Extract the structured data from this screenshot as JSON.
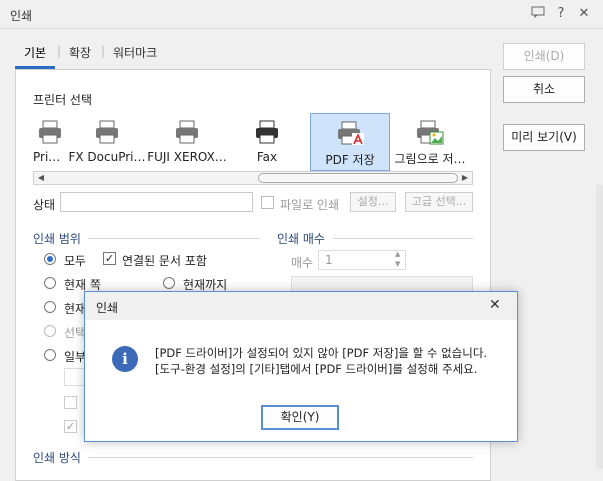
{
  "window": {
    "title": "인쇄"
  },
  "titlebar_icons": [
    "chat-icon",
    "help-icon",
    "close-icon"
  ],
  "tabs": [
    {
      "label": "기본",
      "active": true
    },
    {
      "label": "확장"
    },
    {
      "label": "워터마크"
    }
  ],
  "printer_section": {
    "title": "프린터 선택"
  },
  "printers": [
    {
      "label": "Pri…"
    },
    {
      "label": "FX DocuPri…"
    },
    {
      "label": "FUJI XEROX…"
    },
    {
      "label": "Fax"
    },
    {
      "label": "PDF 저장",
      "selected": true
    },
    {
      "label": "그림으로 저…"
    }
  ],
  "status": {
    "label": "상태",
    "print_to_file": "파일로 인쇄",
    "settings": "설정...",
    "advanced": "고급 선택..."
  },
  "range": {
    "title": "인쇄 범위",
    "all": "모두",
    "linked_docs": "연결된 문서 포함",
    "current_page": "현재 쪽",
    "until_current": "현재까지",
    "current_partial": "현재",
    "selection_partial": "선택",
    "partial_partial": "일부"
  },
  "copies": {
    "title": "인쇄 매수",
    "label": "매수",
    "value": "1"
  },
  "method": {
    "title": "인쇄 방식"
  },
  "buttons": {
    "print": "인쇄(D)",
    "cancel": "취소",
    "preview": "미리 보기(V)"
  },
  "dialog": {
    "title": "인쇄",
    "line1": "[PDF 드라이버]가 설정되어 있지 않아 [PDF 저장]을 할 수 없습니다.",
    "line2": "[도구-환경 설정]의 [기타]탭에서 [PDF 드라이버]를 설정해 주세요.",
    "ok": "확인(Y)",
    "icon": "info-icon"
  },
  "colors": {
    "accent": "#2b6cc4",
    "dialog_border": "#5b8fd3",
    "selected_bg": "#cfe3fb"
  }
}
